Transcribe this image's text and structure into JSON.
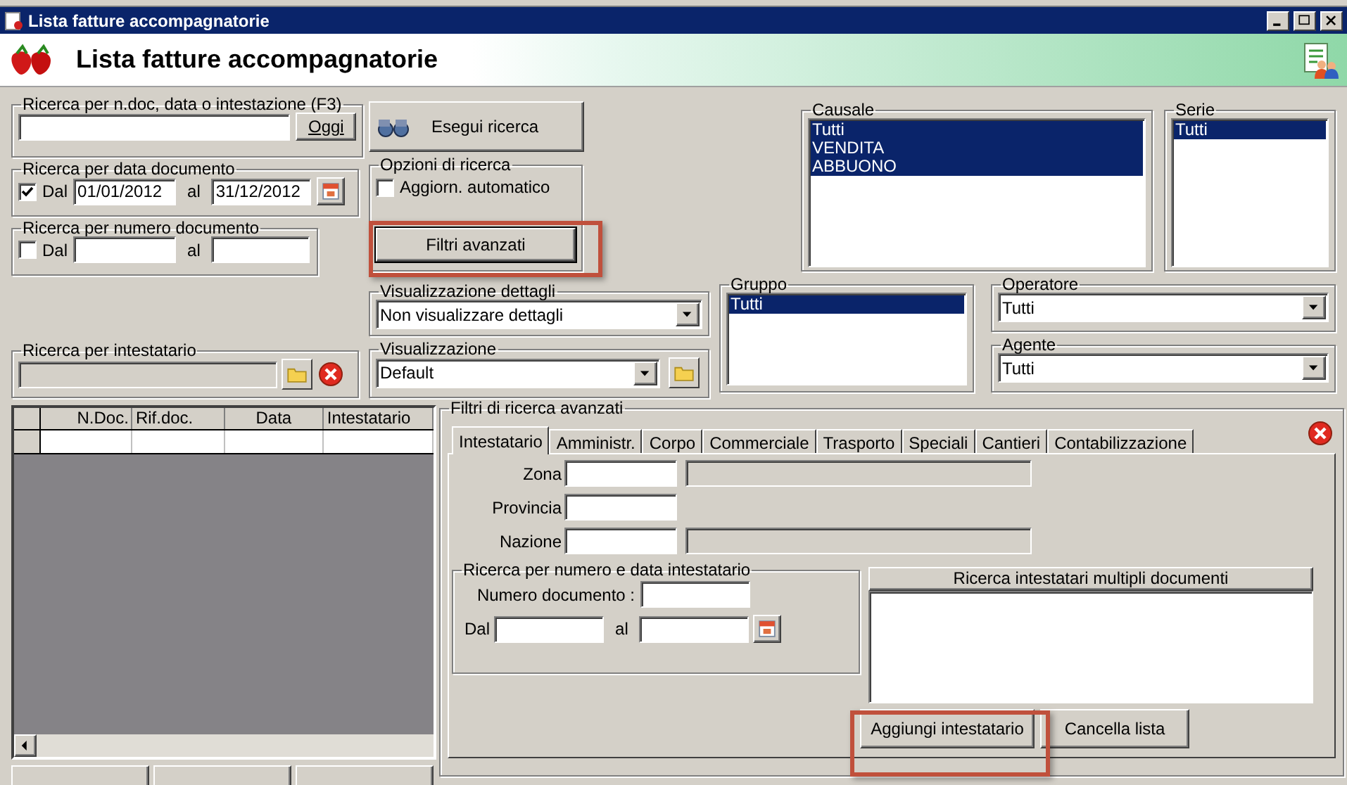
{
  "window": {
    "title": "Lista fatture accompagnatorie"
  },
  "header": {
    "title": "Lista fatture accompagnatorie"
  },
  "text_search": {
    "label": "Ricerca per n.doc, data o intestazione (F3)",
    "button": "Oggi"
  },
  "date_search": {
    "label": "Ricerca per data documento",
    "checked": true,
    "from_label": "Dal",
    "from": "01/01/2012",
    "to_label": "al",
    "to": "31/12/2012"
  },
  "number_search": {
    "label": "Ricerca per numero documento",
    "checked": false,
    "from_label": "Dal",
    "to_label": "al"
  },
  "holder_search": {
    "label": "Ricerca per intestatario"
  },
  "search_button": "Esegui ricerca",
  "options": {
    "label": "Opzioni di ricerca",
    "items": [
      {
        "label": "Aggiorn. automatico",
        "checked": false
      }
    ]
  },
  "advanced_button": "Filtri avanzati",
  "detail_view": {
    "label": "Visualizzazione dettagli",
    "value": "Non visualizzare dettagli"
  },
  "view": {
    "label": "Visualizzazione",
    "value": "Default"
  },
  "causale": {
    "label": "Causale",
    "items": [
      {
        "label": "Tutti",
        "selected": true
      },
      {
        "label": "VENDITA",
        "selected": true
      },
      {
        "label": "ABBUONO",
        "selected": true
      }
    ]
  },
  "serie": {
    "label": "Serie",
    "items": [
      {
        "label": "Tutti",
        "selected": true
      }
    ]
  },
  "gruppo": {
    "label": "Gruppo",
    "items": [
      {
        "label": "Tutti",
        "selected": true
      }
    ]
  },
  "operatore": {
    "label": "Operatore",
    "value": "Tutti"
  },
  "agente": {
    "label": "Agente",
    "value": "Tutti"
  },
  "table": {
    "columns": [
      "N.Doc.",
      "Rif.doc.",
      "Data",
      "Intestatario"
    ]
  },
  "advanced_filters": {
    "title": "Filtri di ricerca avanzati",
    "tabs": [
      {
        "label": "Intestatario",
        "selected": true
      },
      {
        "label": "Amministr.",
        "selected": false
      },
      {
        "label": "Corpo",
        "selected": false
      },
      {
        "label": "Commerciale",
        "selected": false
      },
      {
        "label": "Trasporto",
        "selected": false
      },
      {
        "label": "Speciali",
        "selected": false
      },
      {
        "label": "Cantieri",
        "selected": false
      },
      {
        "label": "Contabilizzazione",
        "selected": false
      }
    ],
    "fields": [
      {
        "label": "Zona",
        "kind": "code_desc"
      },
      {
        "label": "Provincia",
        "kind": "code"
      },
      {
        "label": "Nazione",
        "kind": "code_desc"
      }
    ],
    "holder_group": {
      "label": "Ricerca per numero e data intestatario",
      "number_label": "Numero documento :",
      "from_label": "Dal",
      "to_label": "al"
    },
    "multi_list": {
      "header": "Ricerca intestatari multipli documenti"
    },
    "buttons": [
      "Aggiungi intestatario",
      "Cancella lista"
    ]
  }
}
